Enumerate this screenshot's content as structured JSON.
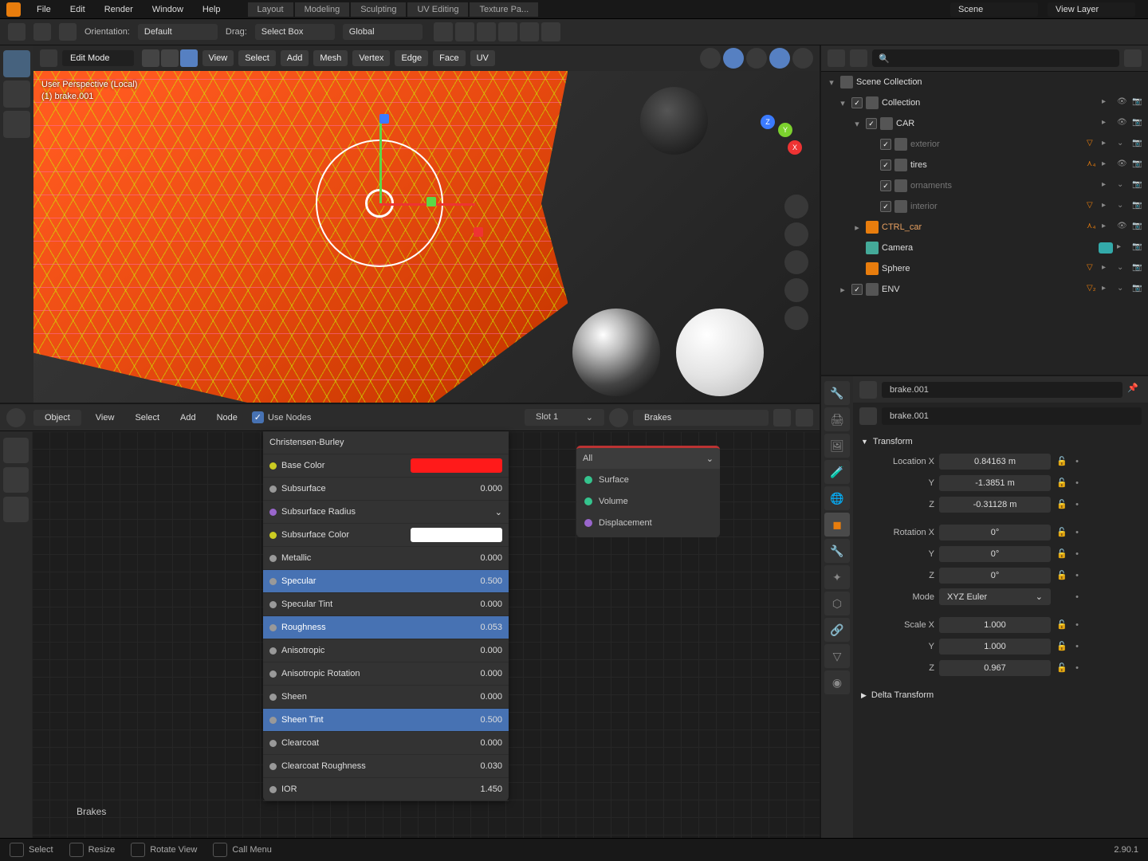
{
  "menu": {
    "items": [
      "File",
      "Edit",
      "Render",
      "Window",
      "Help"
    ],
    "tabs": [
      "Layout",
      "Modeling",
      "Sculpting",
      "UV Editing",
      "Texture Pa..."
    ],
    "scene_label": "Scene",
    "viewlayer_label": "View Layer"
  },
  "toolhdr": {
    "orientation_lbl": "Orientation:",
    "orientation": "Default",
    "drag_lbl": "Drag:",
    "drag": "Select Box",
    "global": "Global"
  },
  "viewport": {
    "mode": "Edit Mode",
    "menus": [
      "View",
      "Select",
      "Add",
      "Mesh",
      "Vertex",
      "Edge",
      "Face",
      "UV"
    ],
    "overlay_line1": "User Perspective (Local)",
    "overlay_line2": "(1) brake.001",
    "gizmo": {
      "x": "X",
      "y": "Y",
      "z": "Z"
    }
  },
  "nodehdr": {
    "object": "Object",
    "menus": [
      "View",
      "Select",
      "Add",
      "Node"
    ],
    "use_nodes": "Use Nodes",
    "slot": "Slot 1",
    "material": "Brakes"
  },
  "bsdf": {
    "title_row": "Christensen-Burley",
    "rows": [
      {
        "k": "basecolor",
        "label": "Base Color",
        "swatch": "#ff1a1a",
        "dot": "y"
      },
      {
        "k": "subsurface",
        "label": "Subsurface",
        "val": "0.000"
      },
      {
        "k": "subrad",
        "label": "Subsurface Radius",
        "dot": "p",
        "dd": true
      },
      {
        "k": "subcol",
        "label": "Subsurface Color",
        "swatch": "#ffffff",
        "dot": "y"
      },
      {
        "k": "metallic",
        "label": "Metallic",
        "val": "0.000"
      },
      {
        "k": "specular",
        "label": "Specular",
        "val": "0.500",
        "sel": true
      },
      {
        "k": "spectint",
        "label": "Specular Tint",
        "val": "0.000"
      },
      {
        "k": "rough",
        "label": "Roughness",
        "val": "0.053",
        "sel": true
      },
      {
        "k": "aniso",
        "label": "Anisotropic",
        "val": "0.000"
      },
      {
        "k": "anisorot",
        "label": "Anisotropic Rotation",
        "val": "0.000"
      },
      {
        "k": "sheen",
        "label": "Sheen",
        "val": "0.000"
      },
      {
        "k": "sheentint",
        "label": "Sheen Tint",
        "val": "0.500",
        "sel": true
      },
      {
        "k": "clear",
        "label": "Clearcoat",
        "val": "0.000"
      },
      {
        "k": "clearr",
        "label": "Clearcoat Roughness",
        "val": "0.030"
      },
      {
        "k": "ior",
        "label": "IOR",
        "val": "1.450"
      }
    ]
  },
  "matout": {
    "all": "All",
    "rows": [
      "Surface",
      "Volume",
      "Displacement"
    ]
  },
  "nodebrk": "Brakes",
  "outliner": {
    "root": "Scene Collection",
    "items": [
      {
        "lvl": 1,
        "name": "Collection",
        "exp": true,
        "chk": true,
        "eye": true
      },
      {
        "lvl": 2,
        "name": "CAR",
        "exp": true,
        "chk": true,
        "eye": true
      },
      {
        "lvl": 3,
        "name": "exterior",
        "chk": true,
        "dim": true
      },
      {
        "lvl": 3,
        "name": "tires",
        "chk": true,
        "or": true,
        "badge": "4"
      },
      {
        "lvl": 3,
        "name": "ornaments",
        "chk": true,
        "dim": true
      },
      {
        "lvl": 3,
        "name": "interior",
        "chk": true,
        "dim": true
      },
      {
        "lvl": 2,
        "name": "CTRL_car",
        "or": true,
        "badge": "4"
      },
      {
        "lvl": 2,
        "name": "Camera",
        "ico": "cam"
      },
      {
        "lvl": 2,
        "name": "Sphere",
        "ico": "mesh"
      },
      {
        "lvl": 1,
        "name": "ENV",
        "chk": true,
        "badge": "2"
      }
    ]
  },
  "props": {
    "object": "brake.001",
    "name": "brake.001",
    "transform": {
      "title": "Transform",
      "location": {
        "x": "0.84163 m",
        "y": "-1.3851 m",
        "z": "-0.31128 m"
      },
      "rotation": {
        "x": "0°",
        "y": "0°",
        "z": "0°"
      },
      "mode_lbl": "Mode",
      "mode": "XYZ Euler",
      "scale": {
        "x": "1.000",
        "y": "1.000",
        "z": "0.967"
      }
    },
    "delta": "Delta Transform",
    "labels": {
      "locx": "Location X",
      "roty": "Rotation X",
      "scalex": "Scale X",
      "y": "Y",
      "z": "Z"
    }
  },
  "footer": {
    "select": "Select",
    "resize": "Resize",
    "rotate": "Rotate View",
    "call": "Call Menu",
    "version": "2.90.1"
  }
}
